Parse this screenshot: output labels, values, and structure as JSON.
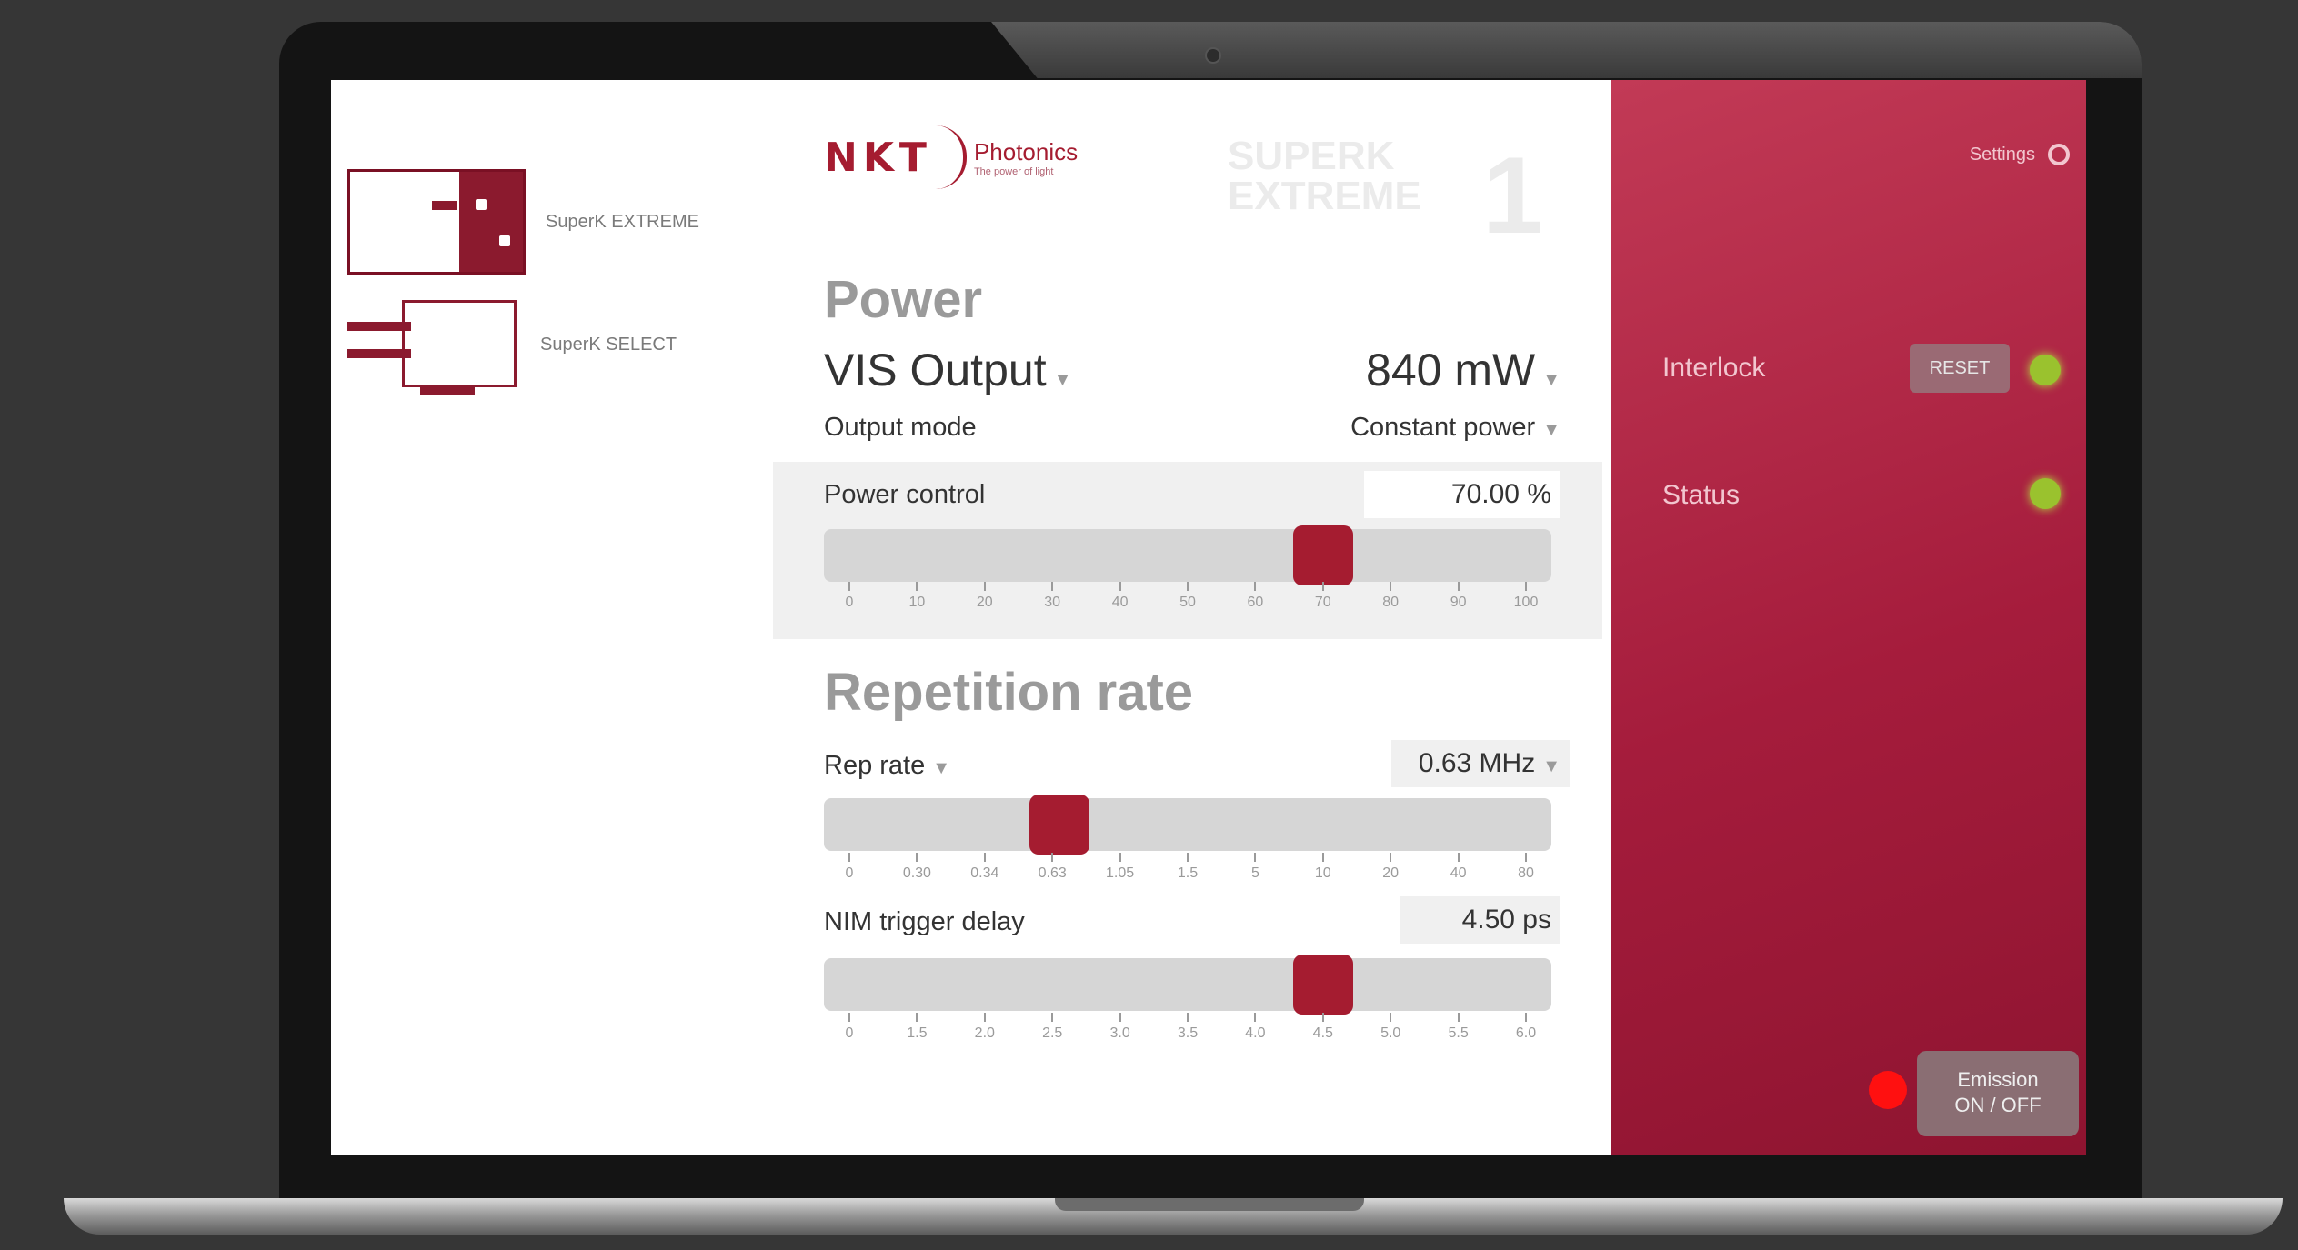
{
  "sidebar": {
    "devices": [
      {
        "label": "SuperK EXTREME"
      },
      {
        "label": "SuperK SELECT"
      }
    ]
  },
  "header": {
    "logo_text": "NKT",
    "logo_subtitle": "Photonics",
    "logo_tagline": "The power of light",
    "watermark_line1": "SUPERK",
    "watermark_line2": "EXTREME",
    "watermark_number": "1"
  },
  "power": {
    "section_title": "Power",
    "output_label": "VIS Output",
    "output_value": "840 mW",
    "output_mode_label": "Output mode",
    "output_mode_value": "Constant power",
    "control_label": "Power control",
    "control_value": "70.00 %",
    "slider_fraction": 0.7,
    "ticks": [
      "0",
      "10",
      "20",
      "30",
      "40",
      "50",
      "60",
      "70",
      "80",
      "90",
      "100"
    ]
  },
  "repetition": {
    "section_title": "Repetition rate",
    "rep_rate_label": "Rep rate",
    "rep_rate_value": "0.63 MHz",
    "rep_slider_fraction": 0.31,
    "rep_ticks": [
      "0",
      "0.30",
      "0.34",
      "0.63",
      "1.05",
      "1.5",
      "5",
      "10",
      "20",
      "40",
      "80"
    ],
    "nim_label": "NIM trigger delay",
    "nim_value": "4.50 ps",
    "nim_slider_fraction": 0.7,
    "nim_ticks": [
      "0",
      "1.5",
      "2.0",
      "2.5",
      "3.0",
      "3.5",
      "4.0",
      "4.5",
      "5.0",
      "5.5",
      "6.0"
    ]
  },
  "status_panel": {
    "settings_label": "Settings",
    "interlock_label": "Interlock",
    "reset_label": "RESET",
    "status_label": "Status",
    "emission_line1": "Emission",
    "emission_line2": "ON / OFF",
    "led_color": "#9ac22e",
    "emission_indicator_color": "#ff1010",
    "accent_color": "#a51c30"
  }
}
